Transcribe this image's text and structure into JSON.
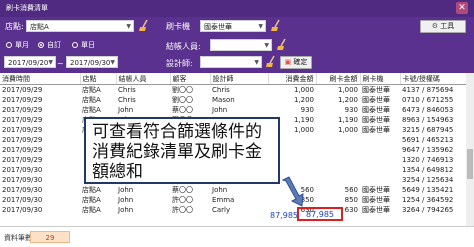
{
  "window": {
    "title": "刷卡消費清單",
    "close": "✕"
  },
  "filters": {
    "store_label": "店點:",
    "store_value": "店點A",
    "machine_label": "刷卡機",
    "machine_value": "國泰世華",
    "settle_person_label": "結帳人員:",
    "designer_label": "設計師:",
    "radios": [
      {
        "label": "單月",
        "selected": false
      },
      {
        "label": "自訂",
        "selected": true
      },
      {
        "label": "單日",
        "selected": false
      }
    ],
    "date_from": "2017/09/20",
    "date_to": "2017/09/30",
    "tilde": "~",
    "confirm_button": "確定",
    "tools_button": "工具"
  },
  "table": {
    "columns": [
      "消費時間",
      "店點",
      "結帳人員",
      "顧客",
      "設計師",
      "消費金額",
      "刷卡金額",
      "刷卡機",
      "卡號/授權碼"
    ],
    "rows": [
      [
        "2017/09/29",
        "店點A",
        "Chris",
        "劉〇〇",
        "Chris",
        "1,000",
        "1,000",
        "國泰世華",
        "4137 / 875694"
      ],
      [
        "2017/09/29",
        "店點A",
        "Chris",
        "劉〇〇",
        "Mason",
        "1,200",
        "1,200",
        "國泰世華",
        "0710 / 671255"
      ],
      [
        "2017/09/29",
        "店點A",
        "John",
        "蔡〇〇",
        "John",
        "930",
        "930",
        "國泰世華",
        "6473 / 846053"
      ],
      [
        "2017/09/29",
        "店點A",
        "John",
        "鄭〇〇",
        "Arron",
        "1,190",
        "1,190",
        "國泰世華",
        "8963 / 154963"
      ],
      [
        "2017/09/29",
        "店點A",
        "John",
        "蔡〇〇",
        "Jason",
        "1,000",
        "1,000",
        "國泰世華",
        "3215 / 687945"
      ],
      [
        "2017/09/29",
        "",
        "",
        "",
        "",
        "",
        "",
        "",
        "5691 / 465213"
      ],
      [
        "2017/09/29",
        "",
        "",
        "",
        "",
        "",
        "",
        "",
        "9647 / 135962"
      ],
      [
        "2017/09/29",
        "",
        "",
        "",
        "",
        "",
        "",
        "",
        "1320 / 746913"
      ],
      [
        "2017/09/30",
        "",
        "",
        "",
        "",
        "",
        "",
        "",
        "1354 / 649812"
      ],
      [
        "2017/09/30",
        "",
        "",
        "",
        "",
        "",
        "",
        "",
        "3254 / 125634"
      ],
      [
        "2017/09/30",
        "店點A",
        "John",
        "蔡〇〇",
        "John",
        "560",
        "560",
        "國泰世華",
        "5649 / 135421"
      ],
      [
        "2017/09/30",
        "店點A",
        "John",
        "許〇〇",
        "Emma",
        "850",
        "850",
        "國泰世華",
        "1254 / 364592"
      ],
      [
        "2017/09/30",
        "店點A",
        "John",
        "許〇〇",
        "Carly",
        "630",
        "630",
        "國泰世華",
        "3264 / 794265"
      ]
    ]
  },
  "totals": {
    "consumption_total": "87,985",
    "card_total": "87,985"
  },
  "callout": {
    "text": "可查看符合篩選條件的消費紀錄清單及刷卡金額總和"
  },
  "status": {
    "label": "資料筆數:",
    "count": "29"
  },
  "colors": {
    "titlebar": "#4f2a80",
    "panel": "#5a318e",
    "total_text": "#1a3fd6",
    "highlight_border": "#e21d1d",
    "callout_border": "#1f3864"
  }
}
